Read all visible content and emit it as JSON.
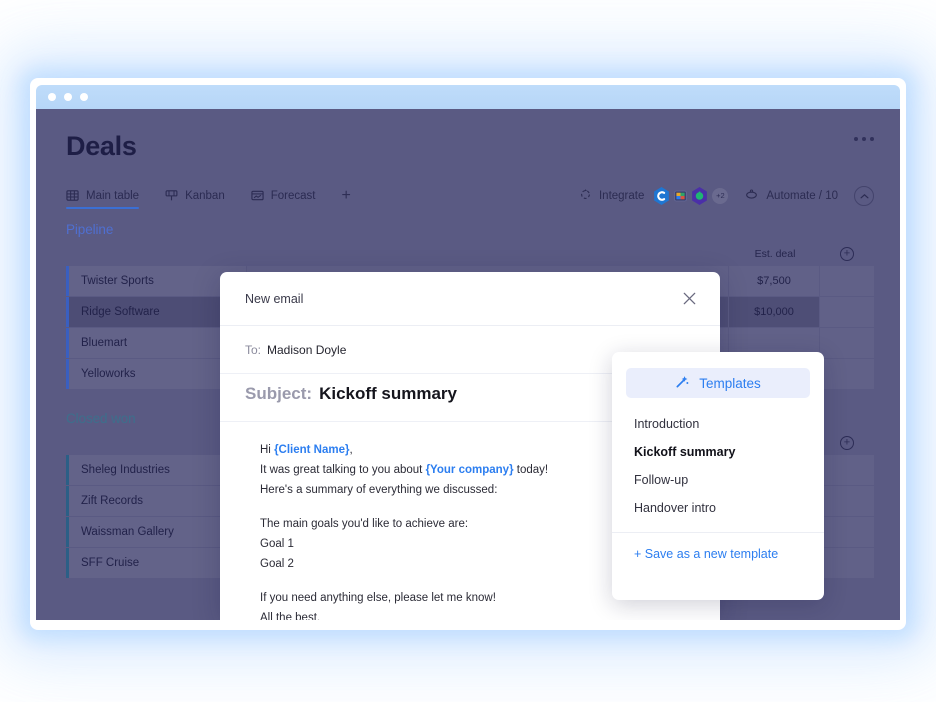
{
  "window": {
    "traffic_dots": 3
  },
  "app": {
    "title": "Deals",
    "overflow_menu": "more-options",
    "tabs": [
      {
        "label": "Main table",
        "icon": "table-icon",
        "active": true
      },
      {
        "label": "Kanban",
        "icon": "kanban-icon",
        "active": false
      },
      {
        "label": "Forecast",
        "icon": "forecast-icon",
        "active": false
      }
    ],
    "add_tab_label": "+",
    "tools": {
      "integrate_label": "Integrate",
      "integration_badges": [
        "monday-hex-c-icon",
        "colored-square-icon",
        "green-hex-icon"
      ],
      "integration_overflow": "+2",
      "automate_label": "Automate / 10",
      "collapse_icon": "chevron-up-icon"
    },
    "columns": {
      "est_deal": "Est. deal",
      "add_column": "+"
    },
    "groups": [
      {
        "name": "Pipeline",
        "color": "#4f6fd0",
        "rows": [
          {
            "name": "Twister Sports",
            "est_deal": "$7,500",
            "selected": false
          },
          {
            "name": "Ridge Software",
            "est_deal": "$10,000",
            "selected": true
          },
          {
            "name": "Bluemart",
            "est_deal": "",
            "selected": false
          },
          {
            "name": "Yelloworks",
            "est_deal": "",
            "selected": false
          }
        ]
      },
      {
        "name": "Closed won",
        "color": "#3d6f8c",
        "rows": [
          {
            "name": "Sheleg Industries",
            "est_deal": "",
            "selected": false
          },
          {
            "name": "Zift Records",
            "est_deal": "",
            "selected": false
          },
          {
            "name": "Waissman Gallery",
            "est_deal": "",
            "selected": false
          },
          {
            "name": "SFF Cruise",
            "est_deal": "",
            "selected": false
          }
        ]
      }
    ]
  },
  "modal": {
    "title": "New email",
    "close_icon": "close-icon",
    "to_label": "To:",
    "to_value": "Madison Doyle",
    "subject_label": "Subject:",
    "subject_value": "Kickoff summary",
    "body": {
      "line1_prefix": "Hi ",
      "line1_placeholder": "{Client Name}",
      "line1_suffix": ",",
      "line2_prefix": "It was great talking to you about ",
      "line2_placeholder": "{Your company}",
      "line2_suffix": " today!",
      "line3": "Here's a summary of everything we discussed:",
      "line4": "The main goals you'd like to achieve are:",
      "line5": "Goal 1",
      "line6": "Goal 2",
      "line7": "If you need anything else, please let me know!",
      "line8": "All the best,"
    }
  },
  "templates_panel": {
    "header_label": "Templates",
    "header_icon": "magic-wand-icon",
    "items": [
      {
        "label": "Introduction",
        "active": false
      },
      {
        "label": "Kickoff summary",
        "active": true
      },
      {
        "label": "Follow-up",
        "active": false
      },
      {
        "label": "Handover intro",
        "active": false
      }
    ],
    "save_label": "+ Save as a new template"
  },
  "colors": {
    "app_bg": "#5a5a83",
    "accent_blue": "#2c7ef0",
    "tab_underline": "#3b6fd4",
    "titlebar": "#bfdcfa"
  }
}
